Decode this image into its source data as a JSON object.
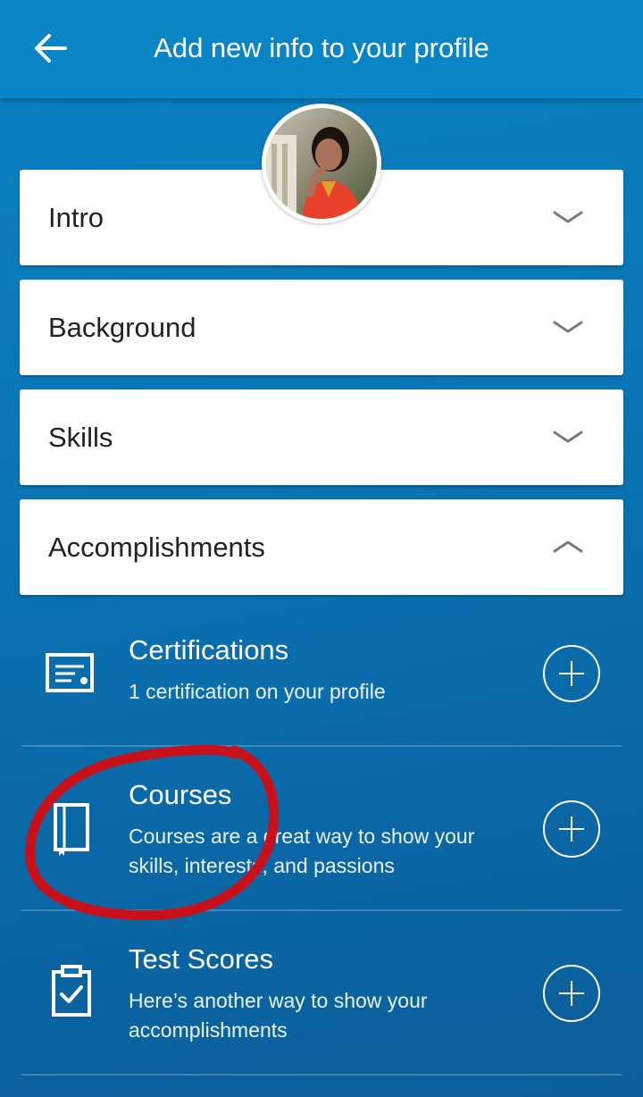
{
  "header": {
    "title": "Add new info to your profile",
    "back_icon": "arrow-left-icon"
  },
  "profile": {
    "avatar_icon": "profile-photo"
  },
  "sections": [
    {
      "label": "Intro",
      "state": "collapsed",
      "chevron": "chevron-down-icon"
    },
    {
      "label": "Background",
      "state": "collapsed",
      "chevron": "chevron-down-icon"
    },
    {
      "label": "Skills",
      "state": "collapsed",
      "chevron": "chevron-down-icon"
    },
    {
      "label": "Accomplishments",
      "state": "expanded",
      "chevron": "chevron-up-icon"
    }
  ],
  "accomplishments": [
    {
      "title": "Certifications",
      "subtitle": "1 certification on your profile",
      "icon": "certificate-icon",
      "action_icon": "add-icon"
    },
    {
      "title": "Courses",
      "subtitle": "Courses are a great way to show your skills, interests, and passions",
      "icon": "book-icon",
      "action_icon": "add-icon"
    },
    {
      "title": "Test Scores",
      "subtitle": "Here’s another way to show your accomplishments",
      "icon": "clipboard-check-icon",
      "action_icon": "add-icon"
    }
  ],
  "colors": {
    "header_blue": "#0a86c6",
    "background_blue": "#0a76b6",
    "annotation_red": "#c8101a"
  }
}
